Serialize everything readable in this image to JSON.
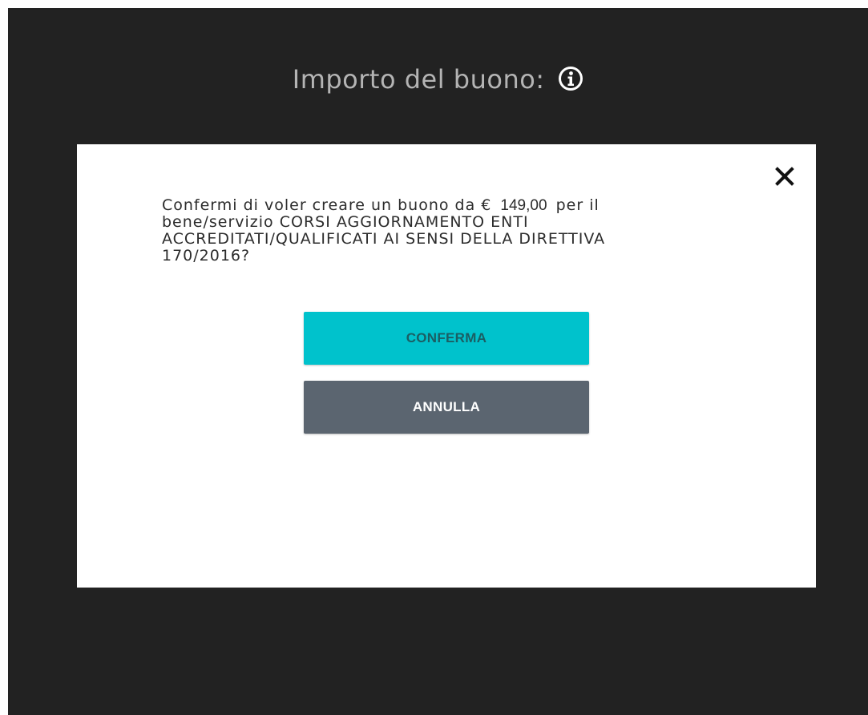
{
  "header": {
    "title": "Importo del buono:",
    "info_icon": "info-icon"
  },
  "colors": {
    "background": "#222222",
    "modal": "#ffffff",
    "confirm": "#00c2cc",
    "cancel": "#5b6570"
  },
  "dialog": {
    "close_icon": "close-icon",
    "message_prefix": "Confermi di voler creare un buono da €",
    "amount": "149,00",
    "message_suffix": "per il bene/servizio CORSI AGGIORNAMENTO ENTI ACCREDITATI/QUALIFICATI AI SENSI DELLA DIRETTIVA 170/2016?",
    "confirm_label": "CONFERMA",
    "cancel_label": "ANNULLA"
  }
}
